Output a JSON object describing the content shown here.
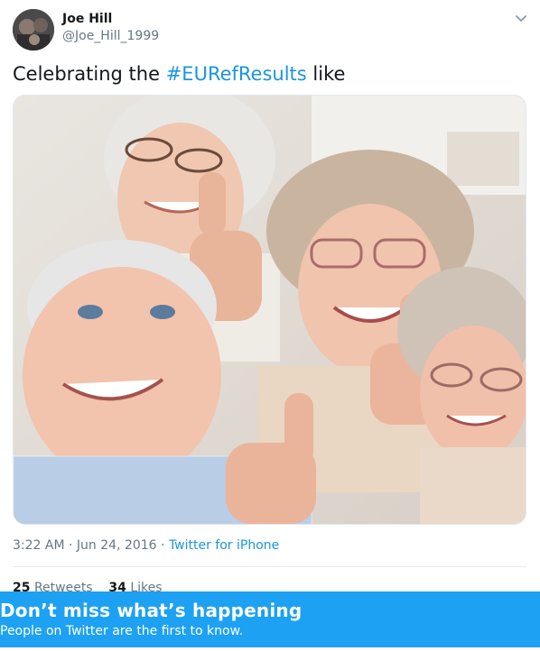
{
  "author": {
    "name": "Joe Hill",
    "handle": "@Joe_Hill_1999"
  },
  "tweet": {
    "text_before": "Celebrating the ",
    "hashtag": "#EURefResults",
    "text_after": " like"
  },
  "photo": {
    "subject": "four smiling elderly people giving thumbs up"
  },
  "meta": {
    "time": "3:22 AM",
    "separator1": " · ",
    "date": "Jun 24, 2016",
    "separator2": " · ",
    "source": "Twitter for iPhone"
  },
  "stats": {
    "retweets_count": "25",
    "retweets_label": "Retweets",
    "likes_count": "34",
    "likes_label": "Likes"
  },
  "banner": {
    "title": "Don’t miss what’s happening",
    "subtitle": "People on Twitter are the first to know."
  },
  "colors": {
    "link": "#1b95e0",
    "banner": "#1da1f2",
    "secondary_text": "#657786"
  },
  "icons": {
    "caret": "chevron-down-icon"
  }
}
